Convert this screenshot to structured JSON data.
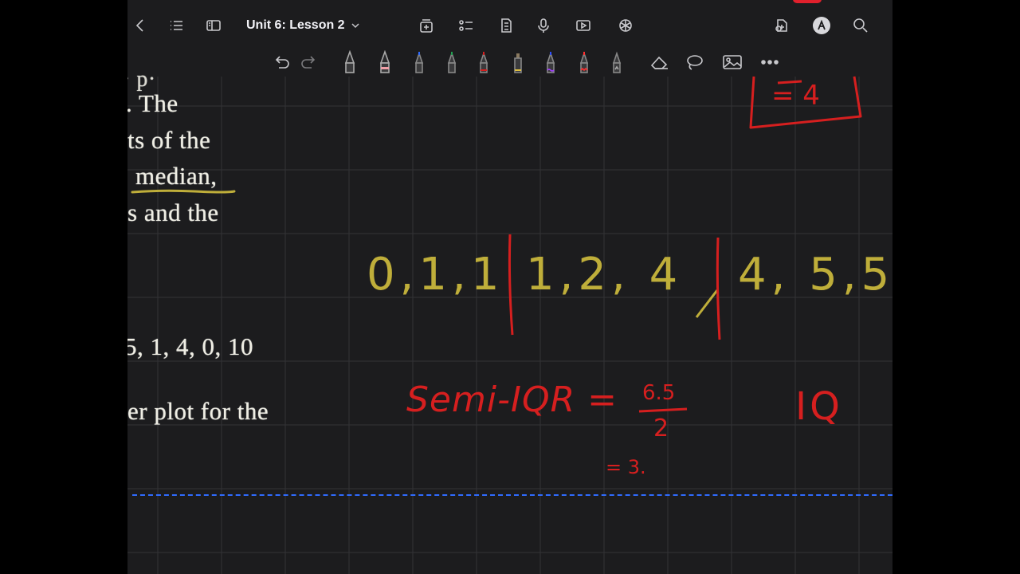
{
  "toolbar": {
    "title": "Unit 6: Lesson 2",
    "icons": [
      "chevron-left-icon",
      "list-icon",
      "sidebar-icon",
      "add-page-icon",
      "checklist-icon",
      "document-icon",
      "microphone-icon",
      "play-icon",
      "openai-icon",
      "share-icon",
      "pencil-circle-icon",
      "search-icon"
    ]
  },
  "tools": {
    "icons": [
      "undo-icon",
      "redo-icon",
      "fountain-pen-icon",
      "pen-red-icon",
      "marker-blue-icon",
      "marker-green-icon",
      "marker-red-icon",
      "highlighter-yellow-icon",
      "marker-purple-icon",
      "marker-red2-icon",
      "pencil-grey-icon",
      "eraser-icon",
      "lasso-icon",
      "image-icon",
      "more-icon"
    ]
  },
  "page": {
    "text_lines": [
      ". The",
      "ts of the",
      "median,",
      "s and the",
      "5, 1, 4, 0, 10",
      "er plot for the"
    ],
    "handwriting": {
      "data_left": "0,1,1",
      "data_mid": "1,2, 4",
      "data_right": "4, 5,5",
      "semi_iqr": "Semi-IQR =",
      "fraction_num": "6.5",
      "fraction_den": "2",
      "result": "= 3.",
      "iqr_partial": "IQ",
      "box_value": "= 4"
    }
  },
  "colors": {
    "ink_yellow": "#bfae3a",
    "ink_red": "#d61f1f",
    "dash_blue": "#2f6bff",
    "background": "#1c1c1e"
  }
}
